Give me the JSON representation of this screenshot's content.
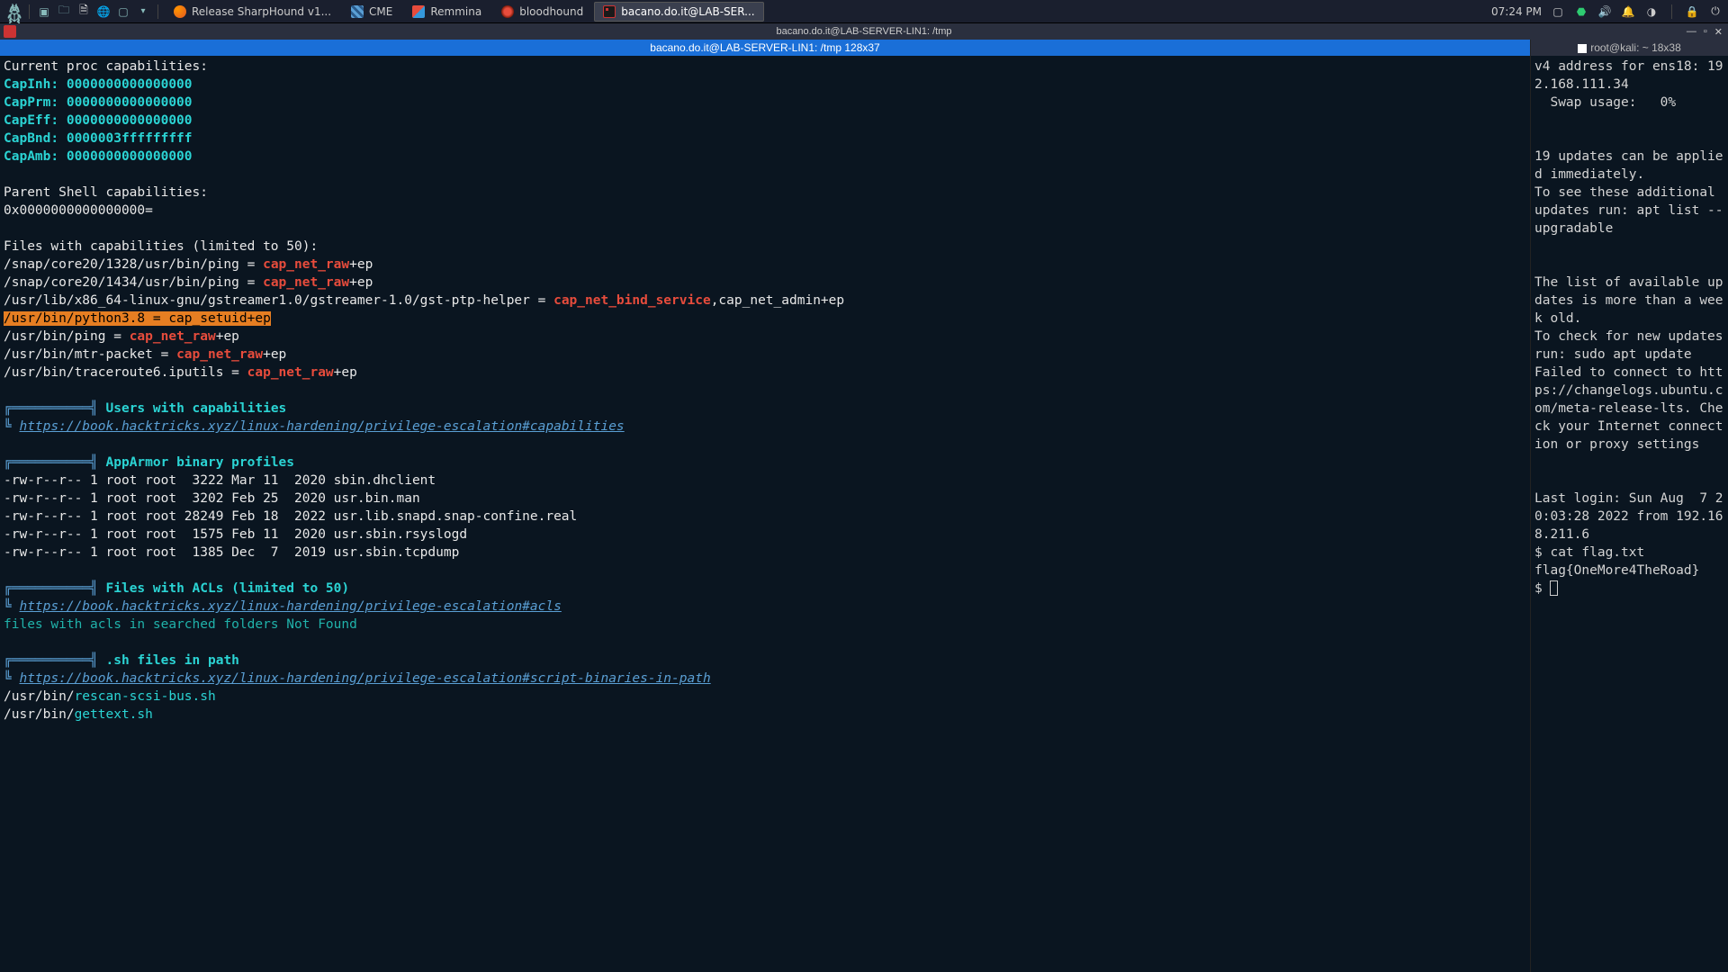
{
  "taskbar": {
    "tabs": [
      {
        "label": "Release SharpHound v1...",
        "icon": "firefox"
      },
      {
        "label": "CME",
        "icon": "cme"
      },
      {
        "label": "Remmina",
        "icon": "remmina"
      },
      {
        "label": "bloodhound",
        "icon": "bloodhound"
      },
      {
        "label": "bacano.do.it@LAB-SER...",
        "icon": "terminal",
        "active": true
      }
    ],
    "clock": "07:24 PM"
  },
  "window": {
    "title": "bacano.do.it@LAB-SERVER-LIN1: /tmp"
  },
  "left_pane": {
    "title": "bacano.do.it@LAB-SERVER-LIN1: /tmp 128x37",
    "content": {
      "h_proc_caps": "Current proc capabilities:",
      "caps": [
        {
          "k": "CapInh:",
          "v": "0000000000000000"
        },
        {
          "k": "CapPrm:",
          "v": "0000000000000000"
        },
        {
          "k": "CapEff:",
          "v": "0000000000000000"
        },
        {
          "k": "CapBnd:",
          "v": "0000003fffffffff"
        },
        {
          "k": "CapAmb:",
          "v": "0000000000000000"
        }
      ],
      "h_parent": "Parent Shell capabilities:",
      "parent_val": "0x0000000000000000=",
      "h_files_caps": "Files with capabilities (limited to 50):",
      "file_caps": [
        {
          "pre": "/snap/core20/1328/usr/bin/ping = ",
          "cap": "cap_net_raw",
          "post": "+ep"
        },
        {
          "pre": "/snap/core20/1434/usr/bin/ping = ",
          "cap": "cap_net_raw",
          "post": "+ep"
        },
        {
          "pre": "/usr/lib/x86_64-linux-gnu/gstreamer1.0/gstreamer-1.0/gst-ptp-helper = ",
          "cap": "cap_net_bind_service",
          "post": ",cap_net_admin+ep"
        },
        {
          "pre": "/usr/bin/python3.8 = ",
          "cap": "cap_setuid",
          "post": "+ep",
          "hl": true
        },
        {
          "pre": "/usr/bin/ping = ",
          "cap": "cap_net_raw",
          "post": "+ep"
        },
        {
          "pre": "/usr/bin/mtr-packet = ",
          "cap": "cap_net_raw",
          "post": "+ep"
        },
        {
          "pre": "/usr/bin/traceroute6.iputils = ",
          "cap": "cap_net_raw",
          "post": "+ep"
        }
      ],
      "sec_users_caps": "Users with capabilities",
      "url_caps": "https://book.hacktricks.xyz/linux-hardening/privilege-escalation#capabilities",
      "sec_apparmor": "AppArmor binary profiles",
      "apparmor": [
        "-rw-r--r-- 1 root root  3222 Mar 11  2020 sbin.dhclient",
        "-rw-r--r-- 1 root root  3202 Feb 25  2020 usr.bin.man",
        "-rw-r--r-- 1 root root 28249 Feb 18  2022 usr.lib.snapd.snap-confine.real",
        "-rw-r--r-- 1 root root  1575 Feb 11  2020 usr.sbin.rsyslogd",
        "-rw-r--r-- 1 root root  1385 Dec  7  2019 usr.sbin.tcpdump"
      ],
      "sec_acls": "Files with ACLs (limited to 50)",
      "url_acls": "https://book.hacktricks.xyz/linux-hardening/privilege-escalation#acls",
      "acls_notfound": "files with acls in searched folders Not Found",
      "sec_sh": ".sh files in path",
      "url_sh": "https://book.hacktricks.xyz/linux-hardening/privilege-escalation#script-binaries-in-path",
      "sh_files": [
        {
          "pre": "/usr/bin/",
          "hi": "rescan-scsi-bus.sh"
        },
        {
          "pre": "/usr/bin/",
          "hi": "gettext.sh"
        }
      ]
    }
  },
  "right_pane": {
    "title": "root@kali: ~ 18x38",
    "lines": [
      "v4 address for ens18: 192.168.111.34",
      "  Swap usage:   0%",
      "",
      "",
      "19 updates can be applied immediately.",
      "To see these additional updates run: apt list --upgradable",
      "",
      "",
      "The list of available updates is more than a week old.",
      "To check for new updates run: sudo apt update",
      "Failed to connect to https://changelogs.ubuntu.com/meta-release-lts. Check your Internet connection or proxy settings",
      "",
      "",
      "Last login: Sun Aug  7 20:03:28 2022 from 192.168.211.6"
    ],
    "prompt": "$ ",
    "cmd": "cat flag.txt",
    "flag": "flag{OneMore4TheRoad}",
    "prompt2": "$ "
  }
}
